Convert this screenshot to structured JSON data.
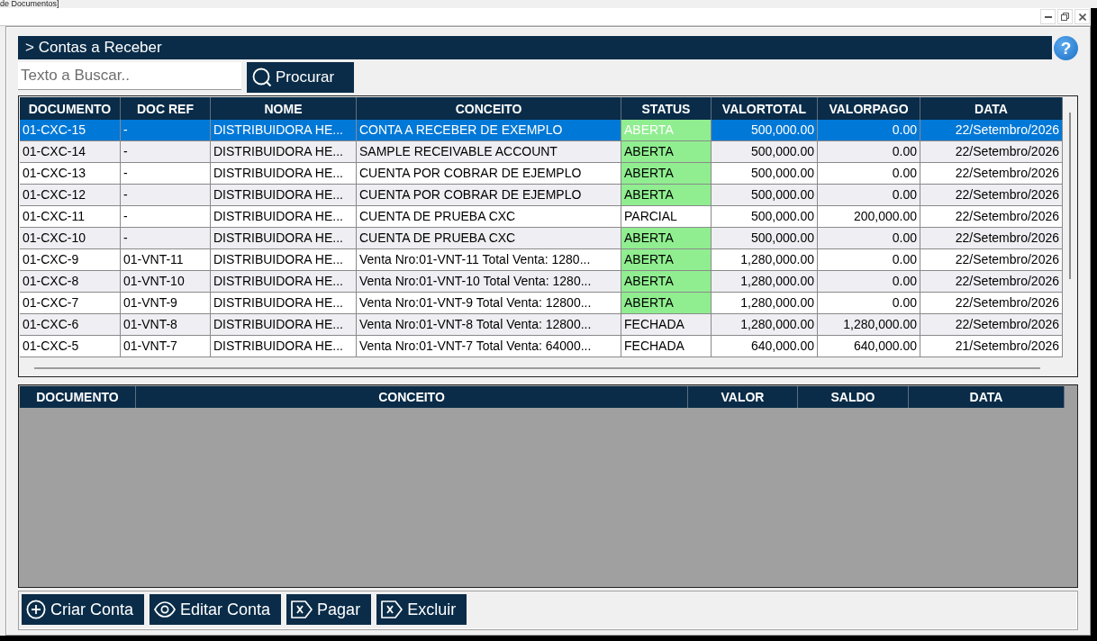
{
  "window": {
    "title": "de Documentos]"
  },
  "section": {
    "title": "> Contas a Receber",
    "help_button": "?"
  },
  "search": {
    "placeholder": "Texto a Buscar..",
    "button": "Procurar"
  },
  "table": {
    "columns": [
      "DOCUMENTO",
      "DOC REF",
      "NOME",
      "CONCEITO",
      "STATUS",
      "VALORTOTAL",
      "VALORPAGO",
      "DATA"
    ],
    "rows": [
      {
        "selected": true,
        "documento": "01-CXC-15",
        "doc_ref": "-",
        "nome": "DISTRIBUIDORA HE...",
        "conceito": "CONTA A RECEBER DE EXEMPLO",
        "status": {
          "text": "ABERTA",
          "color": "#90ee90"
        },
        "valor_total": "500,000.00",
        "valor_pago": "0.00",
        "data": "22/Setembro/2026"
      },
      {
        "selected": false,
        "documento": "01-CXC-14",
        "doc_ref": "-",
        "nome": "DISTRIBUIDORA HE...",
        "conceito": "SAMPLE RECEIVABLE ACCOUNT",
        "status": {
          "text": "ABERTA",
          "color": "#90ee90"
        },
        "valor_total": "500,000.00",
        "valor_pago": "0.00",
        "data": "22/Setembro/2026"
      },
      {
        "selected": false,
        "documento": "01-CXC-13",
        "doc_ref": "-",
        "nome": "DISTRIBUIDORA HE...",
        "conceito": "CUENTA POR COBRAR DE EJEMPLO",
        "status": {
          "text": "ABERTA",
          "color": "#90ee90"
        },
        "valor_total": "500,000.00",
        "valor_pago": "0.00",
        "data": "22/Setembro/2026"
      },
      {
        "selected": false,
        "documento": "01-CXC-12",
        "doc_ref": "-",
        "nome": "DISTRIBUIDORA HE...",
        "conceito": "CUENTA POR COBRAR DE EJEMPLO",
        "status": {
          "text": "ABERTA",
          "color": "#90ee90"
        },
        "valor_total": "500,000.00",
        "valor_pago": "0.00",
        "data": "22/Setembro/2026"
      },
      {
        "selected": false,
        "documento": "01-CXC-11",
        "doc_ref": "-",
        "nome": "DISTRIBUIDORA HE...",
        "conceito": "CUENTA DE PRUEBA CXC",
        "status": {
          "text": "PARCIAL"
        },
        "valor_total": "500,000.00",
        "valor_pago": "200,000.00",
        "data": "22/Setembro/2026"
      },
      {
        "selected": false,
        "documento": "01-CXC-10",
        "doc_ref": "-",
        "nome": "DISTRIBUIDORA HE...",
        "conceito": "CUENTA DE PRUEBA CXC",
        "status": {
          "text": "ABERTA",
          "color": "#90ee90"
        },
        "valor_total": "500,000.00",
        "valor_pago": "0.00",
        "data": "22/Setembro/2026"
      },
      {
        "selected": false,
        "documento": "01-CXC-9",
        "doc_ref": "01-VNT-11",
        "nome": "DISTRIBUIDORA HE...",
        "conceito": "Venta Nro:01-VNT-11 Total Venta: 1280...",
        "status": {
          "text": "ABERTA",
          "color": "#90ee90"
        },
        "valor_total": "1,280,000.00",
        "valor_pago": "0.00",
        "data": "22/Setembro/2026"
      },
      {
        "selected": false,
        "documento": "01-CXC-8",
        "doc_ref": "01-VNT-10",
        "nome": "DISTRIBUIDORA HE...",
        "conceito": "Venta Nro:01-VNT-10 Total Venta: 1280...",
        "status": {
          "text": "ABERTA",
          "color": "#90ee90"
        },
        "valor_total": "1,280,000.00",
        "valor_pago": "0.00",
        "data": "22/Setembro/2026"
      },
      {
        "selected": false,
        "documento": "01-CXC-7",
        "doc_ref": "01-VNT-9",
        "nome": "DISTRIBUIDORA HE...",
        "conceito": "Venta Nro:01-VNT-9 Total Venta: 12800...",
        "status": {
          "text": "ABERTA",
          "color": "#90ee90"
        },
        "valor_total": "1,280,000.00",
        "valor_pago": "0.00",
        "data": "22/Setembro/2026"
      },
      {
        "selected": false,
        "documento": "01-CXC-6",
        "doc_ref": "01-VNT-8",
        "nome": "DISTRIBUIDORA HE...",
        "conceito": "Venta Nro:01-VNT-8 Total Venta: 12800...",
        "status": {
          "text": "FECHADA"
        },
        "valor_total": "1,280,000.00",
        "valor_pago": "1,280,000.00",
        "data": "22/Setembro/2026"
      },
      {
        "selected": false,
        "documento": "01-CXC-5",
        "doc_ref": "01-VNT-7",
        "nome": "DISTRIBUIDORA HE...",
        "conceito": "Venta Nro:01-VNT-7 Total Venta: 64000...",
        "status": {
          "text": "FECHADA"
        },
        "valor_total": "640,000.00",
        "valor_pago": "640,000.00",
        "data": "21/Setembro/2026"
      }
    ]
  },
  "detail_table": {
    "columns": [
      "DOCUMENTO",
      "CONCEITO",
      "VALOR",
      "SALDO",
      "DATA"
    ]
  },
  "buttons": [
    {
      "label": "Criar Conta",
      "kind": "create"
    },
    {
      "label": "Editar Conta",
      "kind": "edit"
    },
    {
      "label": "Pagar",
      "kind": "pay"
    },
    {
      "label": "Excluir",
      "kind": "delete"
    }
  ]
}
